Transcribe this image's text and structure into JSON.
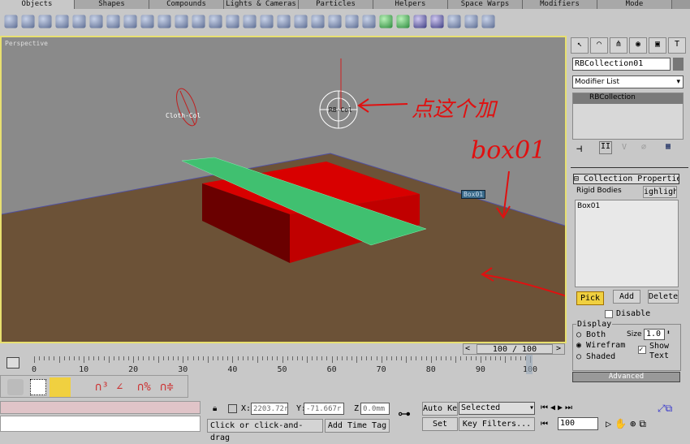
{
  "tabs": [
    "Objects",
    "Shapes",
    "Compounds",
    "Lights & Cameras",
    "Particles",
    "Helpers",
    "Space Warps",
    "Modifiers",
    "Mode"
  ],
  "active_tab": "Objects",
  "viewport": {
    "label": "Perspective",
    "objects": {
      "cloth": "Cloth-Col",
      "rb": "RB-Col",
      "box": "Box01"
    },
    "annotation": {
      "line1": "点这个加",
      "line2": "box01"
    }
  },
  "command_panel": {
    "object_name": "RBCollection01",
    "modifier_list": "Modifier List",
    "stack_item": "RBCollection",
    "rollout_title": "Collection Propertie",
    "rigid_bodies_label": "Rigid Bodies",
    "highlight_button": "ighligh",
    "list_items": [
      "Box01"
    ],
    "pick": "Pick",
    "add": "Add",
    "delete": "Delete",
    "disable": "Disable",
    "display_label": "Display",
    "radio_both": "Both",
    "radio_wire": "Wirefram",
    "radio_shaded": "Shaded",
    "selected_radio": "Wirefram",
    "size_label": "Size",
    "size_value": "1.0",
    "show_text_1": "Show",
    "show_text_2": "Text",
    "show_text_checked": true,
    "advanced": "Advanced"
  },
  "time_slider": {
    "label": "100 / 100",
    "current": 100,
    "max": 100
  },
  "timeline_ticks": [
    "0",
    "10",
    "20",
    "30",
    "40",
    "50",
    "60",
    "70",
    "80",
    "90",
    "100"
  ],
  "status": {
    "x": "2203.72r",
    "y": "-71.667r",
    "z": "0.0mm",
    "x_label": "X:",
    "y_label": "Y:",
    "z_label": "Z:",
    "prompt": "Click or click-and-drag",
    "add_time_tag": "Add Time Tag",
    "auto_key": "Auto Key",
    "set_key": "Set Key",
    "key_mode": "Selected",
    "key_filters": "Key Filters...",
    "frame": "100"
  },
  "colors": {
    "active_border": "#e8e070",
    "pick_button": "#f0d040",
    "box": "#dd0000",
    "plane": "#40c070"
  }
}
